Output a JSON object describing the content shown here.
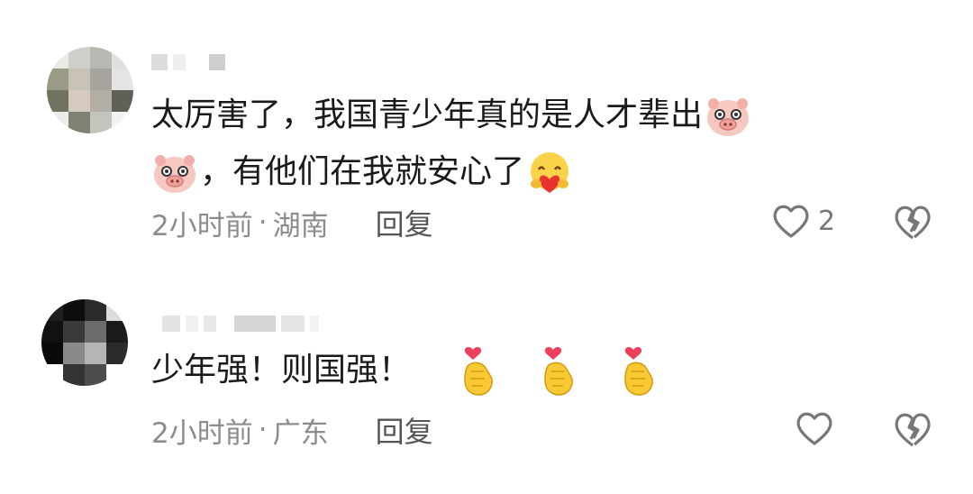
{
  "comments": [
    {
      "text_line1": "太厉害了，我国青少年真的是人才辈出",
      "text_line2": "，有他们在我就安心了",
      "emojis": [
        "pig-face-emoji",
        "pig-face-emoji",
        "heart-hug-emoji"
      ],
      "time": "2小时前",
      "separator": "·",
      "location": "湖南",
      "reply_label": "回复",
      "like_count": "2"
    },
    {
      "text": "少年强！则国强！",
      "emojis": [
        "finger-heart-emoji",
        "finger-heart-emoji",
        "finger-heart-emoji"
      ],
      "time": "2小时前",
      "separator": "·",
      "location": "广东",
      "reply_label": "回复",
      "like_count": ""
    }
  ],
  "colors": {
    "text": "#1a1a1a",
    "meta": "#8c8c8c",
    "reply": "#555555",
    "icon": "#777777"
  }
}
